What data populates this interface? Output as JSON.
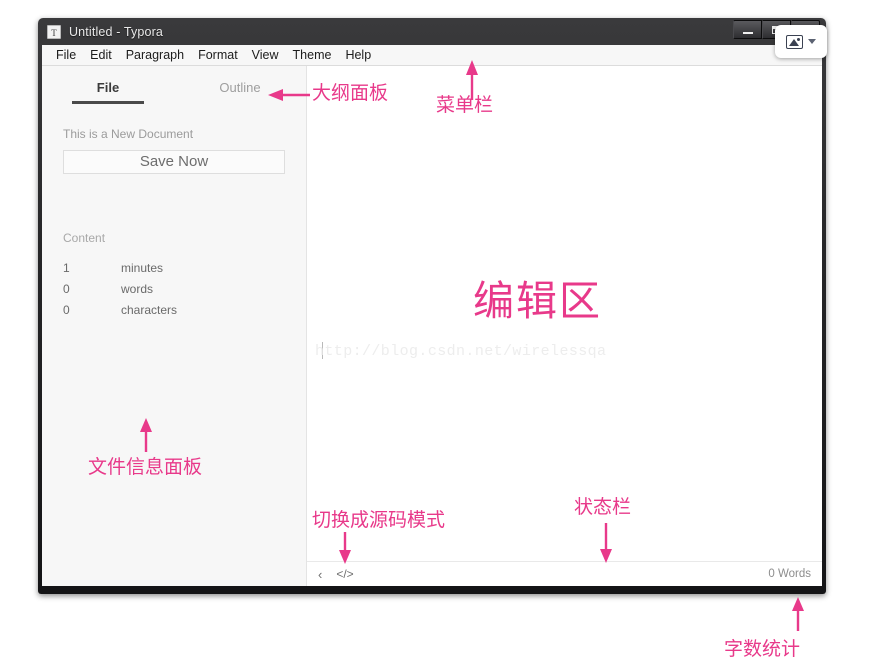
{
  "window": {
    "title": "Untitled - Typora",
    "app_icon": "T",
    "controls": {
      "minimize": "minimize-icon",
      "maximize": "maximize-icon",
      "close": "close-icon"
    }
  },
  "capture_popup": {
    "picture_icon": "picture-icon",
    "caret_icon": "chevron-down-icon"
  },
  "menubar": {
    "items": [
      {
        "label": "File"
      },
      {
        "label": "Edit"
      },
      {
        "label": "Paragraph"
      },
      {
        "label": "Format"
      },
      {
        "label": "View"
      },
      {
        "label": "Theme"
      },
      {
        "label": "Help"
      }
    ]
  },
  "sidebar": {
    "tabs": [
      {
        "label": "File",
        "active": true
      },
      {
        "label": "Outline",
        "active": false
      }
    ],
    "doc_state": "This is a New Document",
    "save_button": "Save Now",
    "content_heading": "Content",
    "stats": [
      {
        "value": "1",
        "label": "minutes"
      },
      {
        "value": "0",
        "label": "words"
      },
      {
        "value": "0",
        "label": "characters"
      }
    ]
  },
  "editor": {
    "watermark": "http://blog.csdn.net/wirelessqa"
  },
  "statusbar": {
    "sidebar_toggle": "‹",
    "source_mode_toggle": "</>",
    "word_count": "0 Words"
  },
  "annotations": {
    "accent_color": "#e8398a",
    "outline_panel": "大纲面板",
    "menu_bar": "菜单栏",
    "edit_area": "编辑区",
    "file_info_panel": "文件信息面板",
    "source_mode": "切换成源码模式",
    "status_bar": "状态栏",
    "word_count_stat": "字数统计"
  }
}
